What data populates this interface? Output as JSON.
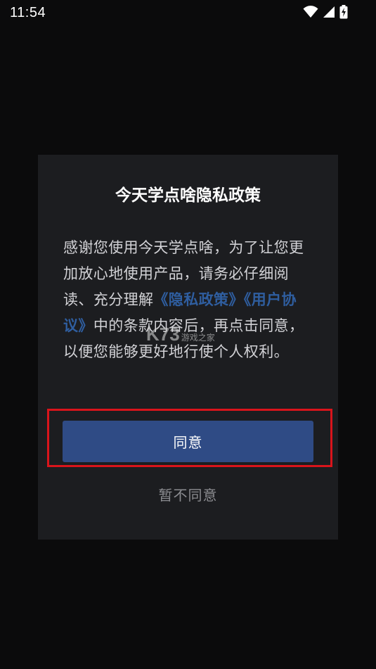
{
  "status_bar": {
    "time": "11:54",
    "icons": [
      "wifi-icon",
      "signal-icon",
      "battery-charging-icon"
    ]
  },
  "dialog": {
    "title": "今天学点啥隐私政策",
    "body": {
      "part1": "感谢您使用今天学点啥，为了让您更加放心地使用产品，请务必仔细阅读、充分理解",
      "privacy_link": "《隐私政策》",
      "user_agreement_link": "《用户协议》",
      "part2": "中的条款内容后，再点击同意，以便您能够更好地行使个人权利。"
    },
    "agree_label": "同意",
    "disagree_label": "暂不同意"
  },
  "watermark": {
    "logo": "K73",
    "text": "游戏之家"
  },
  "colors": {
    "background": "#0b0b0c",
    "dialog": "#1c1d20",
    "link": "#2f5ea0",
    "button": "#2f4b85",
    "highlight": "#d9141b"
  }
}
